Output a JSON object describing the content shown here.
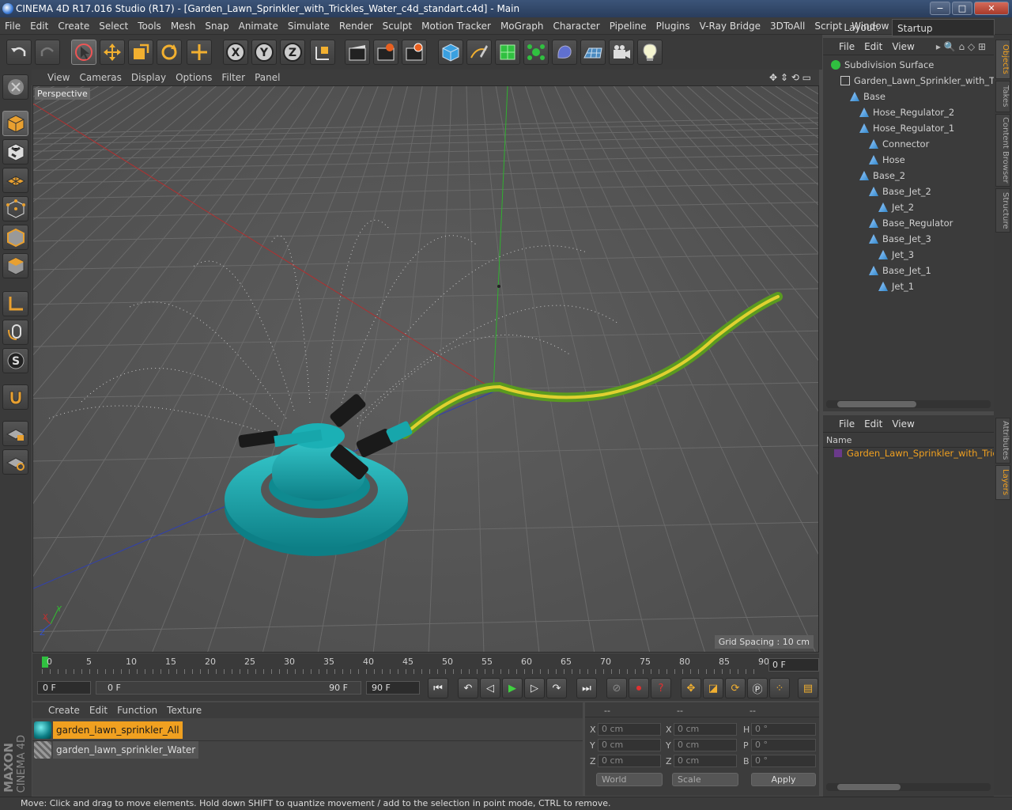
{
  "window": {
    "title": "CINEMA 4D R17.016 Studio (R17) - [Garden_Lawn_Sprinkler_with_Trickles_Water_c4d_standart.c4d] - Main",
    "controls": [
      "−",
      "□",
      "✕"
    ]
  },
  "menubar": {
    "items": [
      "File",
      "Edit",
      "Create",
      "Select",
      "Tools",
      "Mesh",
      "Snap",
      "Animate",
      "Simulate",
      "Render",
      "Sculpt",
      "Motion Tracker",
      "MoGraph",
      "Character",
      "Pipeline",
      "Plugins",
      "V-Ray Bridge",
      "3DToAll",
      "Script",
      "Window"
    ],
    "layout_label": "Layout:",
    "layout_value": "Startup"
  },
  "toolbar": {
    "icons": [
      "undo-icon",
      "redo-icon",
      "live-selection-icon",
      "move-icon",
      "scale-icon",
      "rotate-icon",
      "recent-tool-icon",
      "x-axis-lock-icon",
      "y-axis-lock-icon",
      "z-axis-lock-icon",
      "coordinate-system-icon",
      "render-view-icon",
      "render-picture-viewer-icon",
      "edit-render-settings-icon",
      "cube-icon",
      "pen-spline-icon",
      "subdivision-icon",
      "cloner-icon",
      "deformer-icon",
      "floor-icon",
      "camera-icon",
      "light-icon"
    ]
  },
  "viewport": {
    "menu": [
      "View",
      "Cameras",
      "Display",
      "Options",
      "Filter",
      "Panel"
    ],
    "camera_label": "Perspective",
    "grid_spacing": "Grid Spacing : 10 cm",
    "axis_labels": {
      "x": "X",
      "y": "Y",
      "z": "Z"
    }
  },
  "timeline": {
    "ticks": [
      "0",
      "5",
      "10",
      "15",
      "20",
      "25",
      "30",
      "35",
      "40",
      "45",
      "50",
      "55",
      "60",
      "65",
      "70",
      "75",
      "80",
      "85",
      "90"
    ],
    "current_frame": "0 F"
  },
  "transport": {
    "start_frame": "0 F",
    "range_start": "0 F",
    "range_end": "90 F",
    "end_frame": "90 F"
  },
  "material_manager": {
    "menu": [
      "Create",
      "Edit",
      "Function",
      "Texture"
    ],
    "materials": [
      {
        "name": "garden_lawn_sprinkler_All",
        "selected": true
      },
      {
        "name": "garden_lawn_sprinkler_Water",
        "selected": false
      }
    ]
  },
  "coordinates": {
    "headers": [
      "--",
      "--",
      "--"
    ],
    "rows": [
      {
        "pos_label": "X",
        "pos": "0 cm",
        "size_label": "X",
        "size": "0 cm",
        "rot_label": "H",
        "rot": "0 °"
      },
      {
        "pos_label": "Y",
        "pos": "0 cm",
        "size_label": "Y",
        "size": "0 cm",
        "rot_label": "P",
        "rot": "0 °"
      },
      {
        "pos_label": "Z",
        "pos": "0 cm",
        "size_label": "Z",
        "size": "0 cm",
        "rot_label": "B",
        "rot": "0 °"
      }
    ],
    "mode_world": "World",
    "mode_scale": "Scale",
    "apply_label": "Apply"
  },
  "object_manager": {
    "menu": [
      "File",
      "Edit",
      "View"
    ],
    "tree": [
      {
        "name": "Subdivision Surface",
        "depth": 0
      },
      {
        "name": "Garden_Lawn_Sprinkler_with_Tri",
        "depth": 1
      },
      {
        "name": "Base",
        "depth": 2
      },
      {
        "name": "Hose_Regulator_2",
        "depth": 3
      },
      {
        "name": "Hose_Regulator_1",
        "depth": 3
      },
      {
        "name": "Connector",
        "depth": 4
      },
      {
        "name": "Hose",
        "depth": 4
      },
      {
        "name": "Base_2",
        "depth": 3
      },
      {
        "name": "Base_Jet_2",
        "depth": 4
      },
      {
        "name": "Jet_2",
        "depth": 5
      },
      {
        "name": "Base_Regulator",
        "depth": 4
      },
      {
        "name": "Base_Jet_3",
        "depth": 4
      },
      {
        "name": "Jet_3",
        "depth": 5
      },
      {
        "name": "Base_Jet_1",
        "depth": 4
      },
      {
        "name": "Jet_1",
        "depth": 5
      }
    ]
  },
  "layer_manager": {
    "menu": [
      "File",
      "Edit",
      "View"
    ],
    "column_name": "Name",
    "layers": [
      {
        "name": "Garden_Lawn_Sprinkler_with_Tricl",
        "color": "#6a3a8a"
      }
    ]
  },
  "right_tabs": [
    "Objects",
    "Takes",
    "Content Browser",
    "Structure",
    "Attributes",
    "Layers"
  ],
  "brand": {
    "line1": "MAXON",
    "line2": "CINEMA 4D"
  },
  "status": "Move: Click and drag to move elements. Hold down SHIFT to quantize movement / add to the selection in point mode, CTRL to remove.",
  "colors": {
    "accent": "#f0a020",
    "sprinkler": "#1fa3a8",
    "hose_green": "#7fbf2a",
    "hose_yellow": "#e0d030",
    "x_axis": "#c03030",
    "y_axis": "#30c030",
    "z_axis": "#3040c0"
  }
}
